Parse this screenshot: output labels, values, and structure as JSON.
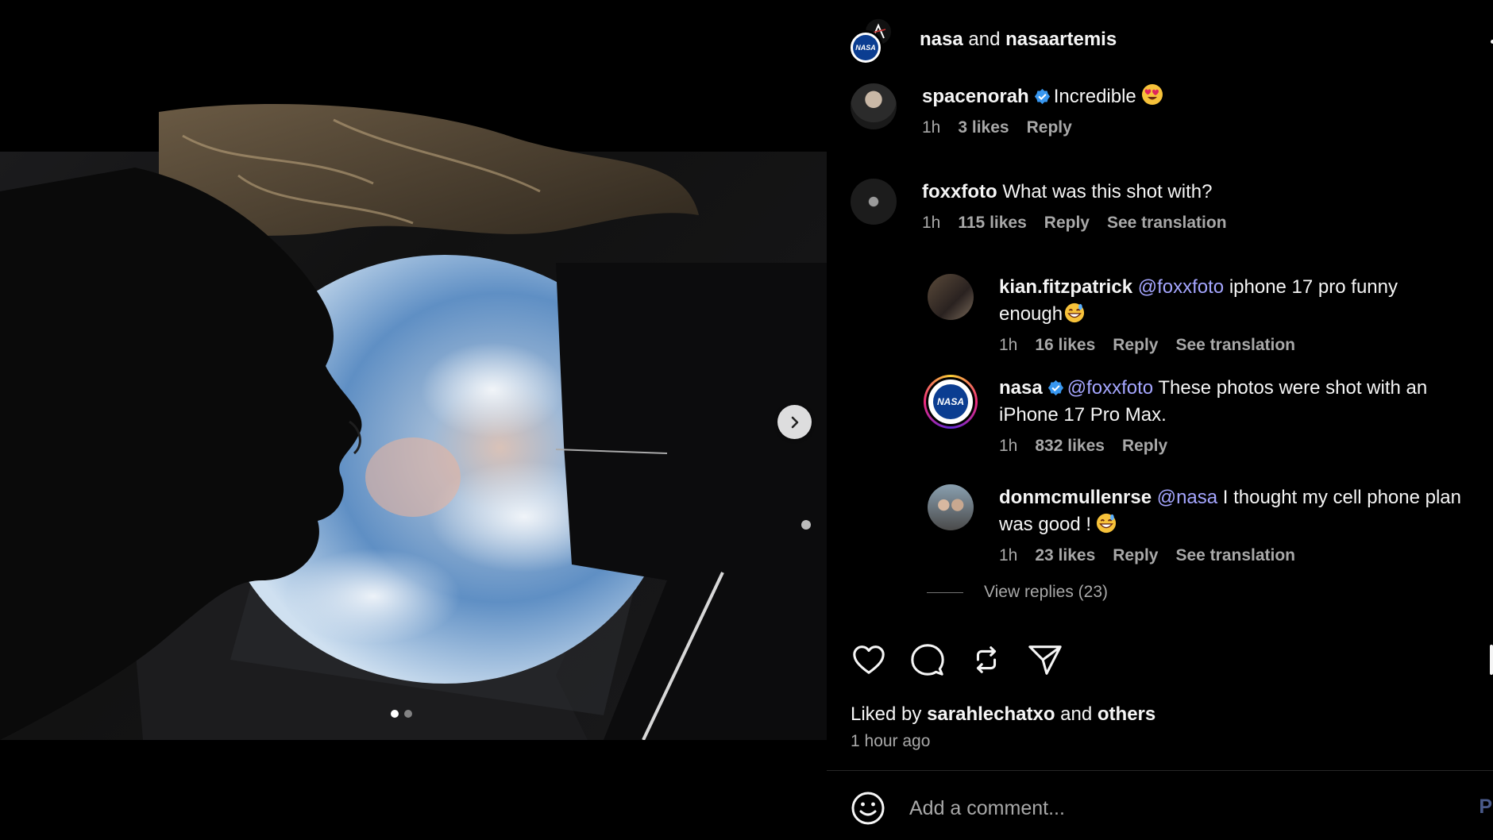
{
  "post": {
    "header": {
      "account_1": "nasa",
      "joiner": "and",
      "account_2": "nasaartemis",
      "nasa_logo_text": "NASA"
    },
    "carousel": {
      "slide_count": 2,
      "current_slide": 1
    }
  },
  "comments": [
    {
      "user": "spacenorah",
      "verified": true,
      "text": "Incredible",
      "emoji": "heart-eyes",
      "time": "1h",
      "likes": "3 likes",
      "reply": "Reply",
      "translate": ""
    },
    {
      "user": "foxxfoto",
      "verified": false,
      "text": "What was this shot with?",
      "time": "1h",
      "likes": "115 likes",
      "reply": "Reply",
      "translate": "See translation"
    }
  ],
  "replies": [
    {
      "user": "kian.fitzpatrick",
      "mention": "@foxxfoto",
      "text_line1": "iphone 17 pro funny",
      "text_line2": "enough",
      "emoji": "grinning-sweat",
      "time": "1h",
      "likes": "16 likes",
      "reply": "Reply",
      "translate": "See translation"
    },
    {
      "user": "nasa",
      "verified": true,
      "mention": "@foxxfoto",
      "text_line1": "These photos were shot with an",
      "text_line2": "iPhone 17 Pro Max.",
      "time": "1h",
      "likes": "832 likes",
      "reply": "Reply",
      "avatar_text": "NASA"
    },
    {
      "user": "donmcmullenrse",
      "mention": "@nasa",
      "text_line1": "I thought my cell phone plan",
      "text_line2": "was good !",
      "emoji": "grinning-sweat",
      "time": "1h",
      "likes": "23 likes",
      "reply": "Reply",
      "translate": "See translation"
    }
  ],
  "view_replies": "View replies (23)",
  "actions": {
    "icons": [
      "heart-icon",
      "comment-icon",
      "repost-icon",
      "share-icon"
    ]
  },
  "likes_line": {
    "prefix": "Liked by",
    "user": "sarahlechatxo",
    "joiner": "and",
    "others": "others"
  },
  "timestamp": "1 hour ago",
  "add_comment": {
    "placeholder": "Add a comment...",
    "post_label": "P"
  },
  "colors": {
    "background": "#000000",
    "mention": "#a5a6ff",
    "verified": "#3897f0",
    "muted": "#a8a8a8"
  }
}
